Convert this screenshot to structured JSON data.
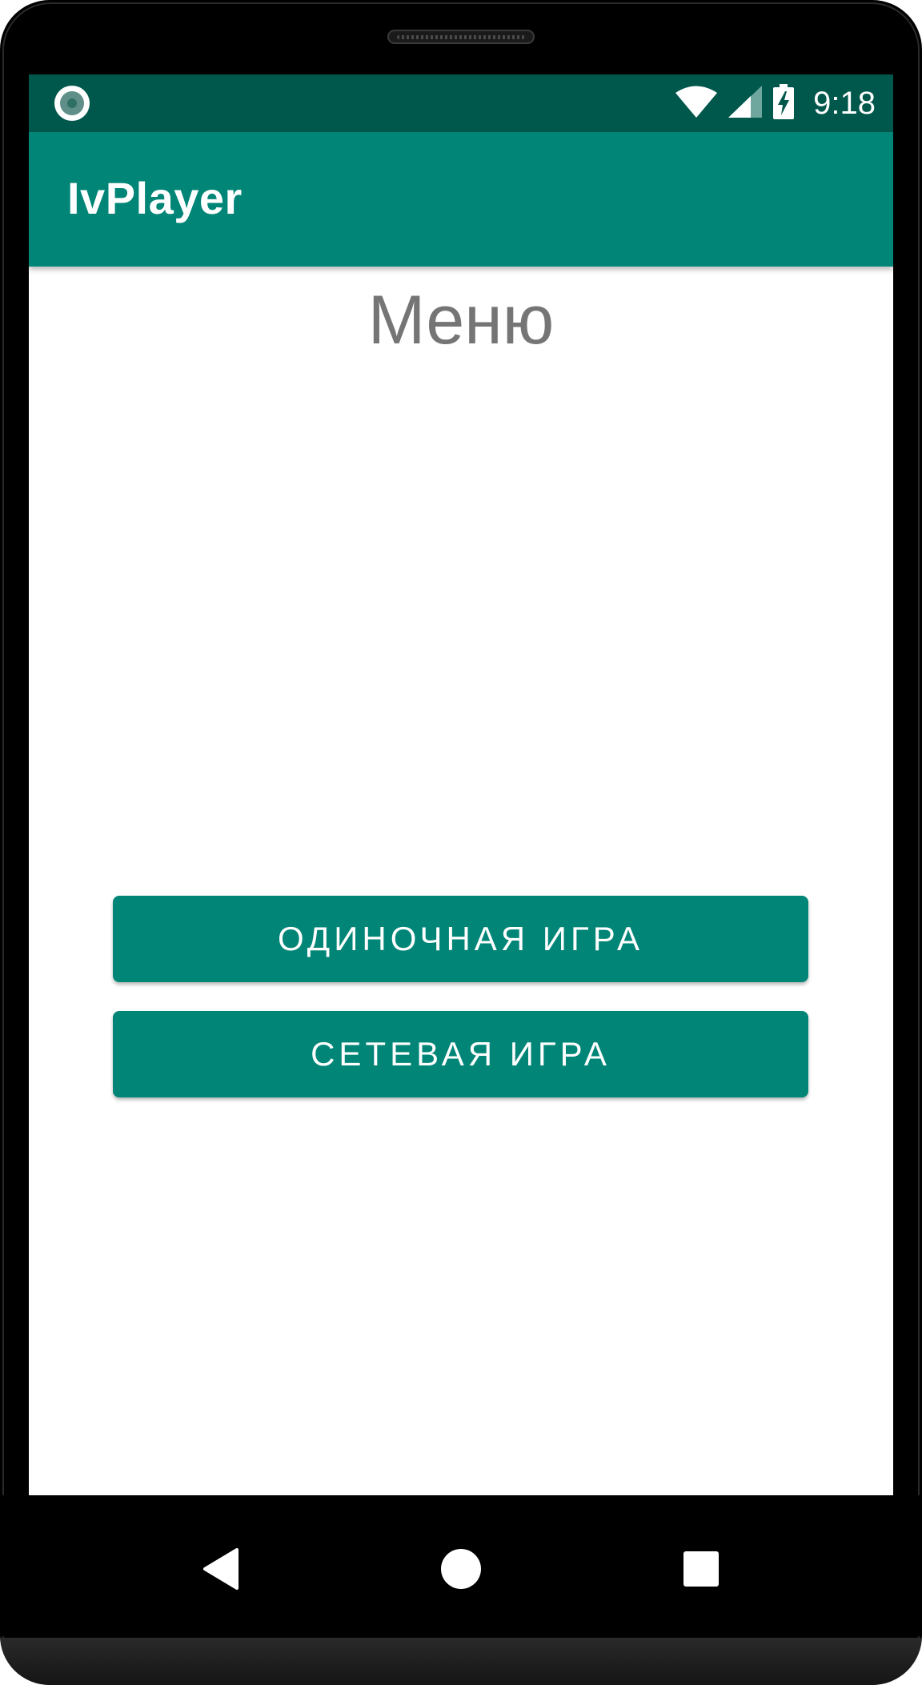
{
  "status_bar": {
    "time": "9:18",
    "left_icon": "record-dot-icon",
    "icons": [
      "wifi-icon",
      "cell-signal-icon",
      "battery-charging-icon"
    ],
    "color": "#00574b"
  },
  "app_bar": {
    "title": "IvPlayer",
    "color": "#008577"
  },
  "main": {
    "heading": "Меню",
    "buttons": [
      {
        "label": "ОДИНОЧНАЯ ИГРА"
      },
      {
        "label": "СЕТЕВАЯ ИГРА"
      }
    ]
  },
  "nav_bar": {
    "items": [
      "back-icon",
      "home-icon",
      "recents-icon"
    ]
  }
}
